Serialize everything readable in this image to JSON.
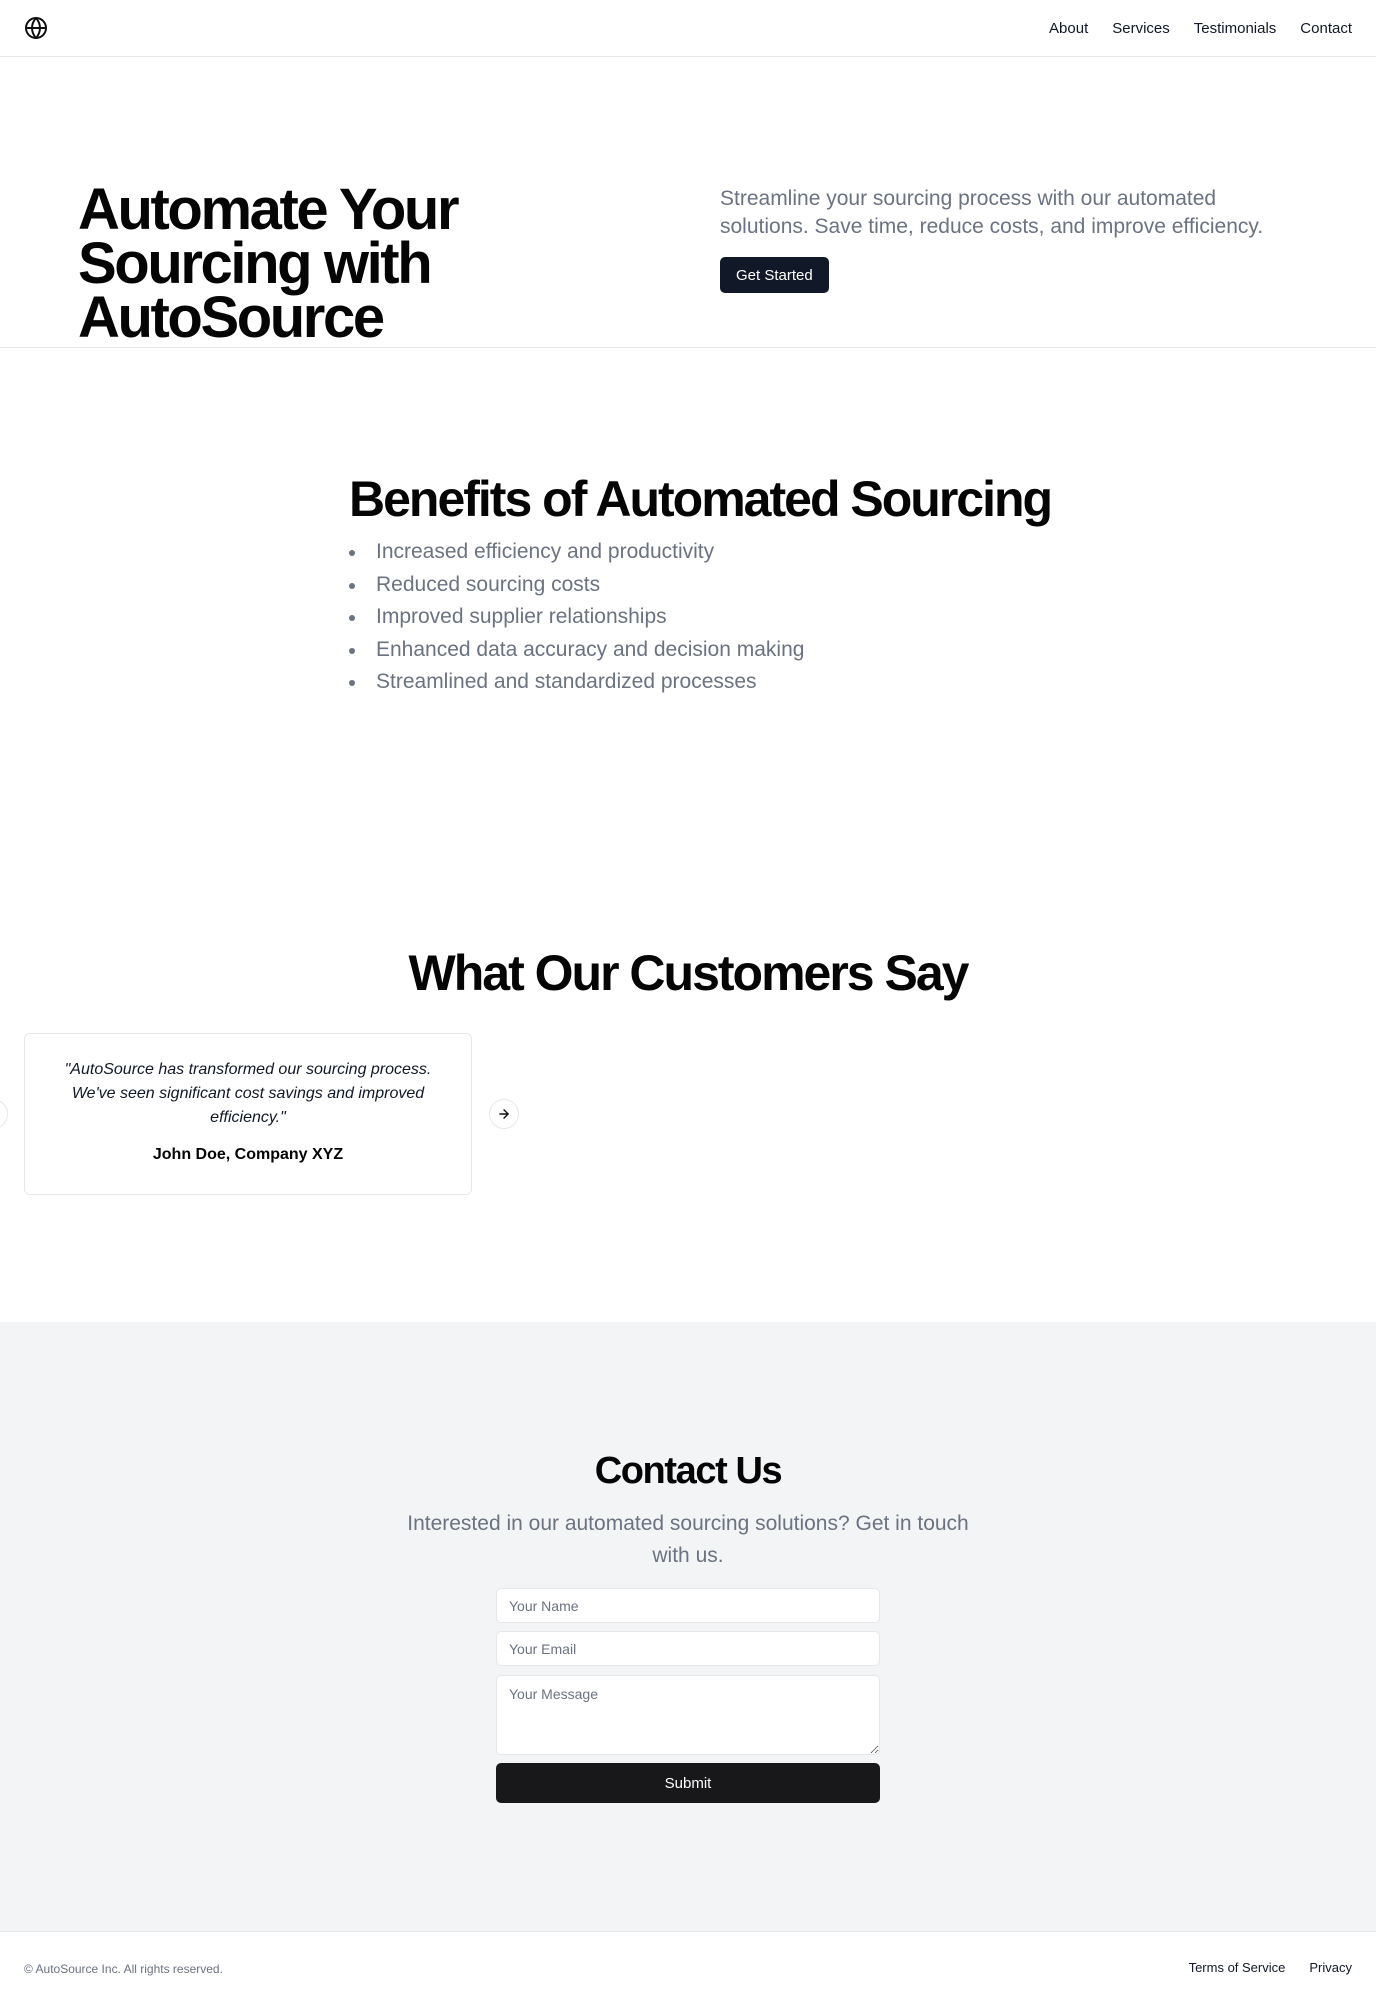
{
  "header": {
    "logo_icon": "globe-icon",
    "nav": [
      "About",
      "Services",
      "Testimonials",
      "Contact"
    ]
  },
  "hero": {
    "title": "Automate Your Sourcing with AutoSource",
    "description": "Streamline your sourcing process with our automated solutions. Save time, reduce costs, and improve efficiency.",
    "cta_label": "Get Started"
  },
  "benefits": {
    "title": "Benefits of Automated Sourcing",
    "items": [
      "Increased efficiency and productivity",
      "Reduced sourcing costs",
      "Improved supplier relationships",
      "Enhanced data accuracy and decision making",
      "Streamlined and standardized processes"
    ]
  },
  "testimonials": {
    "title": "What Our Customers Say",
    "items": [
      {
        "quote": "\"AutoSource has transformed our sourcing process. We've seen significant cost savings and improved efficiency.\"",
        "author": "John Doe, Company XYZ"
      }
    ],
    "next_icon": "arrow-right-icon",
    "prev_icon": "arrow-left-icon"
  },
  "contact": {
    "title": "Contact Us",
    "description": "Interested in our automated sourcing solutions? Get in touch with us.",
    "name_placeholder": "Your Name",
    "email_placeholder": "Your Email",
    "message_placeholder": "Your Message",
    "submit_label": "Submit"
  },
  "footer": {
    "copyright": "© AutoSource Inc. All rights reserved.",
    "links": [
      "Terms of Service",
      "Privacy"
    ]
  },
  "colors": {
    "primary": "#111827",
    "muted_text": "#6b7280",
    "contact_bg": "#f3f4f6",
    "border": "#e5e7eb"
  }
}
